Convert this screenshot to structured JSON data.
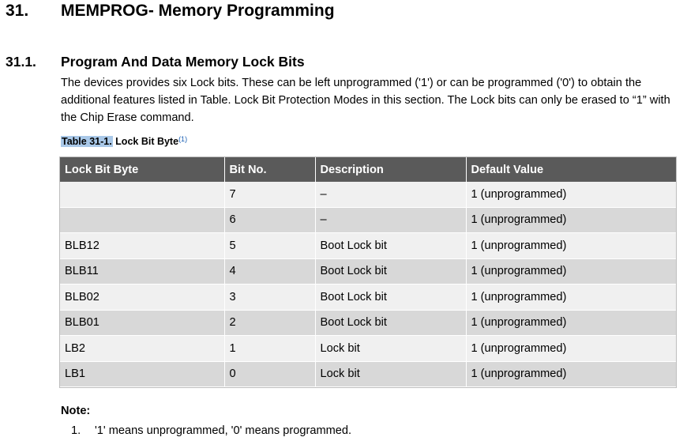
{
  "heading1": {
    "number": "31.",
    "text": "MEMPROG- Memory Programming"
  },
  "heading2": {
    "number": "31.1.",
    "text": "Program And Data Memory Lock Bits"
  },
  "paragraph": "The devices provides six Lock bits. These can be left unprogrammed ('1') or can be programmed ('0') to obtain the additional features listed in Table. Lock Bit Protection Modes in this section. The Lock bits can only be erased to “1” with the Chip Erase command.",
  "caption": {
    "tag": "Table 31-1.",
    "title": "Lock Bit Byte",
    "footnote_ref": "(1)"
  },
  "table": {
    "headers": [
      "Lock Bit Byte",
      "Bit No.",
      "Description",
      "Default Value"
    ],
    "rows": [
      [
        "",
        "7",
        "–",
        "1 (unprogrammed)"
      ],
      [
        "",
        "6",
        "–",
        "1 (unprogrammed)"
      ],
      [
        "BLB12",
        "5",
        "Boot Lock bit",
        "1 (unprogrammed)"
      ],
      [
        "BLB11",
        "4",
        "Boot Lock bit",
        "1 (unprogrammed)"
      ],
      [
        "BLB02",
        "3",
        "Boot Lock bit",
        "1 (unprogrammed)"
      ],
      [
        "BLB01",
        "2",
        "Boot Lock bit",
        "1 (unprogrammed)"
      ],
      [
        "LB2",
        "1",
        "Lock bit",
        "1 (unprogrammed)"
      ],
      [
        "LB1",
        "0",
        "Lock bit",
        "1 (unprogrammed)"
      ]
    ]
  },
  "note": {
    "title": "Note:",
    "items": [
      {
        "number": "1.",
        "text": "'1' means unprogrammed, '0' means programmed."
      }
    ]
  },
  "colors": {
    "header_bg": "#5a5a5a",
    "row_light": "#f0f0f0",
    "row_dark": "#d8d8d8",
    "caption_highlight": "#a9c8e8",
    "footnote_link": "#1a5fb4"
  }
}
